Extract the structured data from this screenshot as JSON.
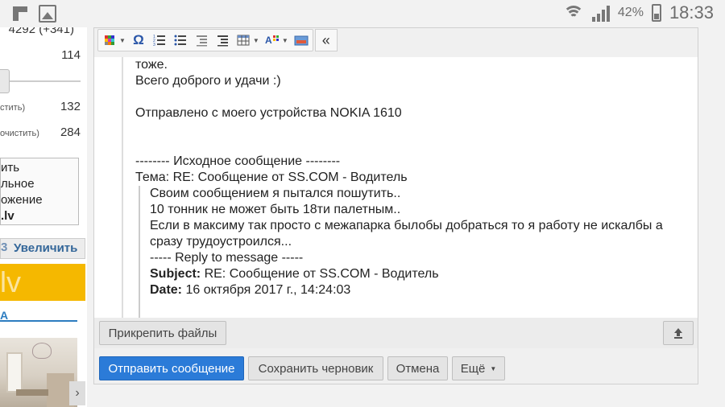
{
  "status_bar": {
    "battery_percent": "42%",
    "time": "18:33"
  },
  "sidebar": {
    "top_stat": "4292 (+341)",
    "stat_2": "114",
    "filter_1_label": "стить)",
    "filter_1_count": "132",
    "filter_2_label": "очистить)",
    "filter_2_count": "284",
    "list_items": [
      "ить",
      "льное",
      "ожение",
      ".lv"
    ],
    "zoom_prefix": "3",
    "zoom_label": "Увеличить",
    "banner_text": "lv",
    "section_letter": "A",
    "scroll_arrow": "›"
  },
  "toolbar": {
    "items": [
      "grid-color-icon",
      "omega-icon",
      "ordered-list-icon",
      "unordered-list-icon",
      "outdent-icon",
      "indent-icon",
      "table-icon",
      "text-color-icon",
      "image-icon",
      "collapse-icon"
    ]
  },
  "message": {
    "lines": [
      "тоже.",
      "Всего доброго и удачи :)",
      "",
      "Отправлено с моего устройства NOKIA 1610",
      "",
      "",
      "-------- Исходное сообщение --------",
      "Тема: RE: Сообщение от SS.COM - Водитель"
    ],
    "quote": {
      "line1": "Своим сообщением я пытался пошутить..",
      "line2": "10 тонник не может быть 18ти палетным..",
      "line3": "Если в максиму так просто с межапарка былобы добраться то я работу не искалбы а сразу трудоустроился...",
      "reply_header": "----- Reply to message -----",
      "subject_label": "Subject:",
      "subject_value": " RE: Сообщение от SS.COM - Водитель",
      "date_label": "Date:",
      "date_value": " 16 октября 2017 г., 14:24:03"
    }
  },
  "actions": {
    "attach_files": "Прикрепить файлы",
    "send": "Отправить сообщение",
    "save_draft": "Сохранить черновик",
    "cancel": "Отмена",
    "more": "Ещё"
  },
  "colors": {
    "primary": "#2b7bd8",
    "banner": "#f5b800",
    "link_blue": "#336699"
  }
}
